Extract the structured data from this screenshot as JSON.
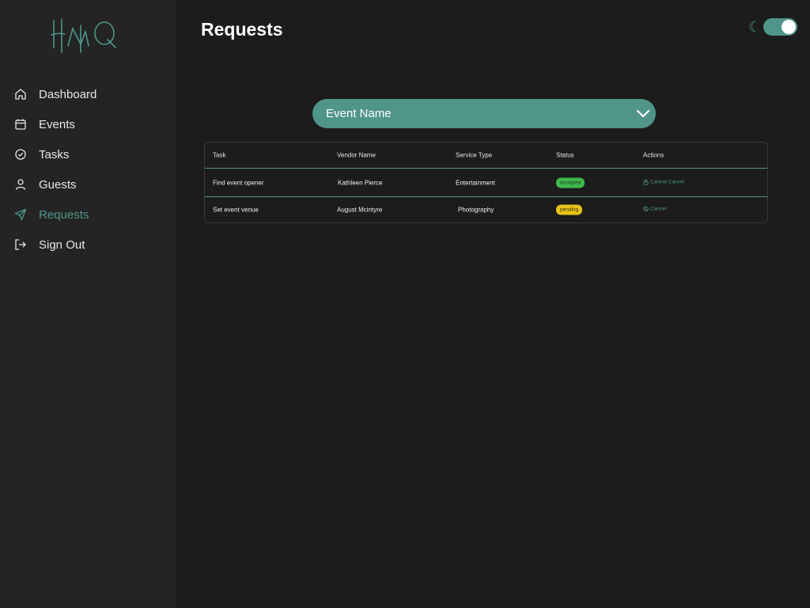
{
  "brand": {
    "logo_text": "HMQ",
    "accent": "#4f958a"
  },
  "sidebar": {
    "items": [
      {
        "label": "Dashboard",
        "icon": "home-icon",
        "active": false
      },
      {
        "label": "Events",
        "icon": "calendar-icon",
        "active": false
      },
      {
        "label": "Tasks",
        "icon": "check-circle-icon",
        "active": false
      },
      {
        "label": "Guests",
        "icon": "user-icon",
        "active": false
      },
      {
        "label": "Requests",
        "icon": "send-icon",
        "active": true
      },
      {
        "label": "Sign Out",
        "icon": "sign-out-icon",
        "active": false
      }
    ]
  },
  "header": {
    "title": "Requests",
    "theme_icon": "moon-icon",
    "dark_mode": true
  },
  "event_select": {
    "value": "Event Name",
    "icon": "chevron-down-icon"
  },
  "table": {
    "columns": [
      "Task",
      "Vendor Name",
      "Service Type",
      "Status",
      "Actions"
    ],
    "rows": [
      {
        "task": "Find event opener",
        "vendor": "Kathleen Pierce",
        "service": "Entertainment",
        "status": "accepted",
        "action": "Cannot Cancel",
        "action_icon": "lock-icon"
      },
      {
        "task": "Set event venue",
        "vendor": "August Mcintyre",
        "service": "Photography",
        "status": "pending",
        "action": "Cancel",
        "action_icon": "ban-icon"
      }
    ]
  },
  "colors": {
    "accepted": "#3fb84c",
    "pending": "#e7c21a",
    "background": "#1c1c1c",
    "sidebar": "#242424"
  }
}
